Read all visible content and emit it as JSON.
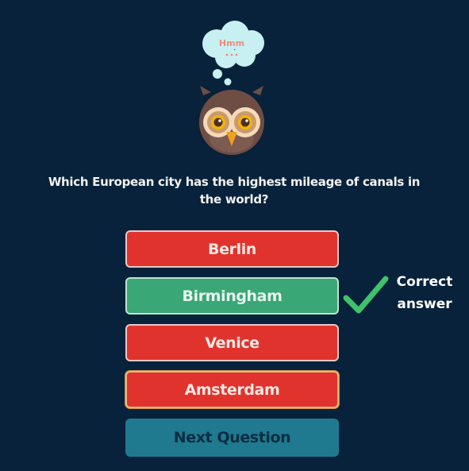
{
  "quiz": {
    "thought_bubble_text": "Hmm",
    "question": "Which European city has the highest mileage of canals in the world?",
    "answers": [
      {
        "label": "Berlin",
        "state": "wrong"
      },
      {
        "label": "Birmingham",
        "state": "correct"
      },
      {
        "label": "Venice",
        "state": "wrong"
      },
      {
        "label": "Amsterdam",
        "state": "wrong-selected"
      }
    ],
    "next_label": "Next Question"
  },
  "annotation": {
    "label": "Correct answer"
  },
  "colors": {
    "background": "#07223a",
    "wrong": "#e1332e",
    "correct": "#3ba676",
    "next_button": "#1f7a8f",
    "check_mark": "#3ec36a",
    "owl_face": "#6e4d44"
  },
  "icons": {
    "mascot": "owl-thinking",
    "annotation": "check-icon"
  }
}
